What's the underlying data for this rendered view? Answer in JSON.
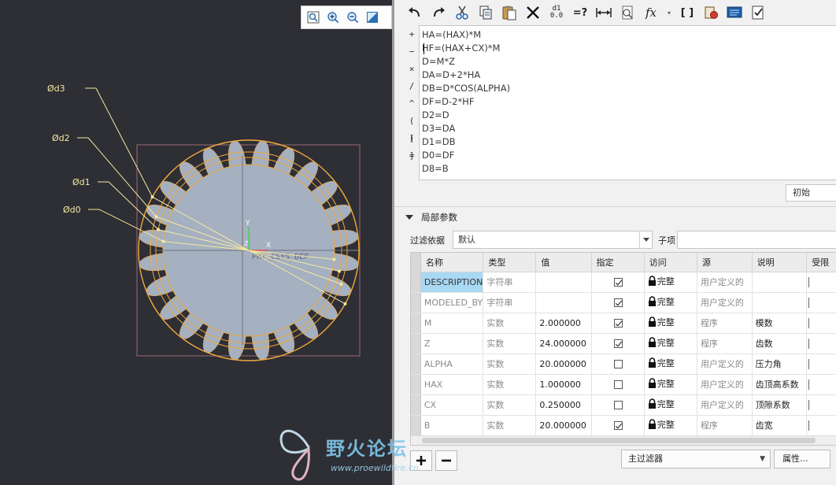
{
  "viewport": {
    "dim_labels": [
      "Ød3",
      "Ød2",
      "Ød1",
      "Ød0"
    ],
    "csys_label": "PRT_CSYS_DEF",
    "axis_x": "X",
    "axis_y": "Y",
    "axis_z": "Z",
    "gear_teeth": 24,
    "colors": {
      "background": "#2e2e35",
      "gear_fill": "#a5b0c0",
      "annotation": "#f4e9a0",
      "circle": "#f2a93b"
    }
  },
  "toolbar": {
    "undo_icon": "undo-icon",
    "redo_icon": "redo-icon",
    "cut_icon": "cut-icon",
    "copy_icon": "copy-icon",
    "paste_icon": "paste-icon",
    "delete_icon": "delete-icon",
    "eval_icon": "evaluate-icon",
    "eval_top": "d1",
    "eval_bottom": "0.0",
    "verify_label": "=?",
    "insert_dimension_icon": "dimension-icon",
    "sort_icon": "sort-icon",
    "fx_label": "fx",
    "bracket_label": "[ ]",
    "param_icon": "parameter-icon",
    "display_icon": "display-icon",
    "check_icon": "check-icon"
  },
  "operators": [
    "+",
    "−",
    "×",
    "/",
    "^",
    "( )",
    "[ ]",
    "="
  ],
  "relations": [
    "HA=(HAX)*M",
    "HF=(HAX+CX)*M",
    "D=M*Z",
    "DA=D+2*HA",
    "DB=D*COS(ALPHA)",
    "DF=D-2*HF",
    "D2=D",
    "D3=DA",
    "D1=DB",
    "D0=DF",
    "D8=B"
  ],
  "state_dropdown": "初始",
  "local_params": {
    "section_title": "局部参数",
    "filter_label": "过滤依据",
    "filter_value": "默认",
    "sub_label": "子项",
    "columns": [
      "名称",
      "类型",
      "值",
      "指定",
      "访问",
      "源",
      "说明",
      "受限"
    ],
    "rows": [
      {
        "name": "DESCRIPTION",
        "type": "字符串",
        "value": "",
        "designated": true,
        "access": "完整",
        "source": "用户定义的",
        "desc": ""
      },
      {
        "name": "MODELED_BY",
        "type": "字符串",
        "value": "",
        "designated": true,
        "access": "完整",
        "source": "用户定义的",
        "desc": ""
      },
      {
        "name": "M",
        "type": "实数",
        "value": "2.000000",
        "designated": true,
        "access": "完整",
        "source": "程序",
        "desc": "模数"
      },
      {
        "name": "Z",
        "type": "实数",
        "value": "24.000000",
        "designated": true,
        "access": "完整",
        "source": "程序",
        "desc": "齿数"
      },
      {
        "name": "ALPHA",
        "type": "实数",
        "value": "20.000000",
        "designated": false,
        "access": "完整",
        "source": "用户定义的",
        "desc": "压力角"
      },
      {
        "name": "HAX",
        "type": "实数",
        "value": "1.000000",
        "designated": false,
        "access": "完整",
        "source": "用户定义的",
        "desc": "齿顶高系数"
      },
      {
        "name": "CX",
        "type": "实数",
        "value": "0.250000",
        "designated": false,
        "access": "完整",
        "source": "用户定义的",
        "desc": "顶隙系数"
      },
      {
        "name": "B",
        "type": "实数",
        "value": "20.000000",
        "designated": true,
        "access": "完整",
        "source": "程序",
        "desc": "齿宽"
      }
    ]
  },
  "bottom": {
    "add_label": "+",
    "remove_label": "−",
    "main_filter_label": "主过滤器",
    "properties_label": "属性..."
  },
  "watermark": {
    "text": "野火论坛",
    "url": "www.proewildfire.cn"
  }
}
